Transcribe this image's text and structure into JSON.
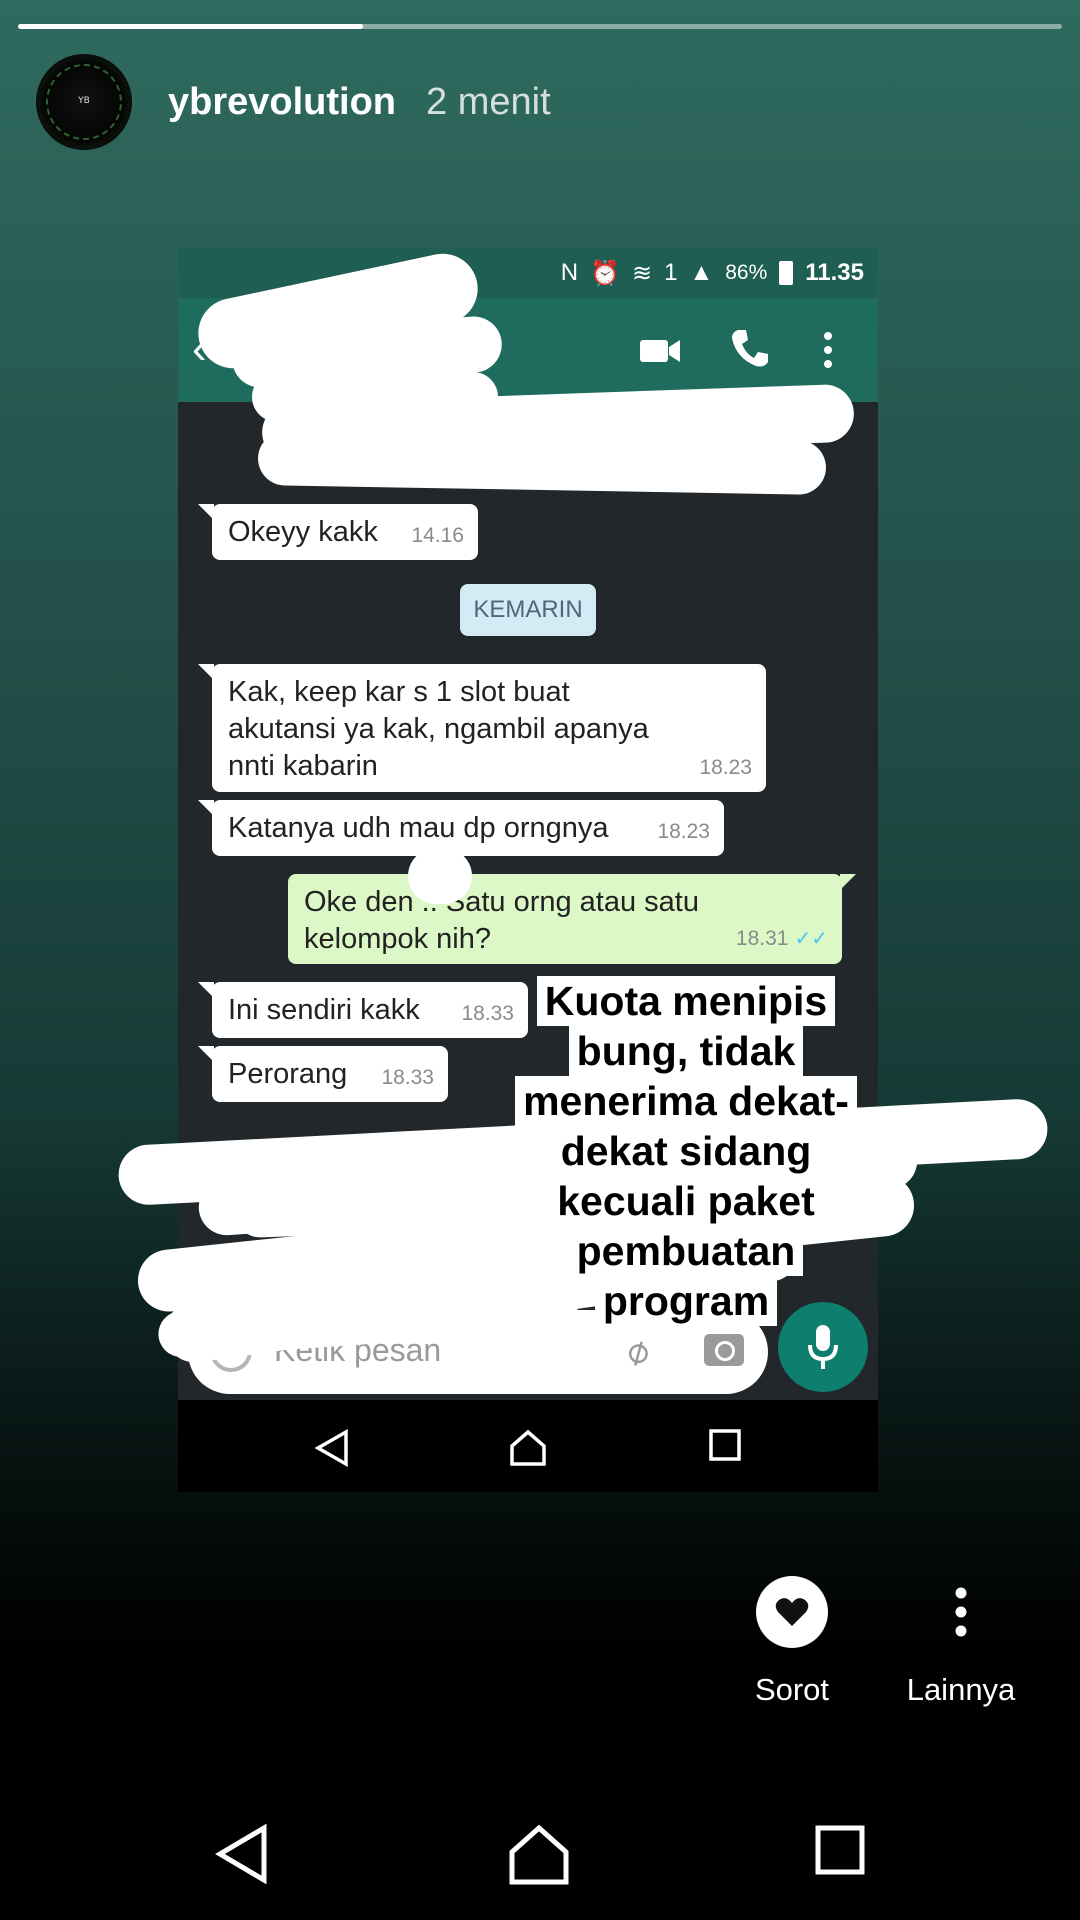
{
  "story": {
    "progress": 0.33,
    "username": "ybrevolution",
    "time_ago": "2 menit",
    "avatar_text": "YBRevolution"
  },
  "screenshot": {
    "status_bar": {
      "battery": "86%",
      "time": "11.35",
      "sim": "1"
    },
    "chat_partner_redacted": true,
    "date_divider": "KEMARIN",
    "messages": [
      {
        "direction": "in",
        "text": "Okeyy kakk",
        "time": "14.16"
      },
      {
        "direction": "in",
        "text": "Kak, keep kar   s 1 slot buat akutansi ya kak, ngambil apanya nnti  kabarin",
        "time": "18.23"
      },
      {
        "direction": "in",
        "text": "Katanya udh mau dp orngnya",
        "time": "18.23"
      },
      {
        "direction": "out",
        "text": "Oke den   .. Satu orng atau satu kelompok nih?",
        "time": "18.31"
      },
      {
        "direction": "in",
        "text": "Ini sendiri kakk",
        "time": "18.33"
      },
      {
        "direction": "in",
        "text": "Perorang",
        "time": "18.33"
      }
    ],
    "input_placeholder": "Ketik pesan"
  },
  "caption": "Kuota menipis bung, tidak menerima dekat-dekat sidang kecuali paket pembuatan program",
  "actions": {
    "highlight_label": "Sorot",
    "more_label": "Lainnya"
  },
  "colors": {
    "whatsapp_header": "#1f6b5e",
    "outgoing_bubble": "#dcf8c6",
    "mic_button": "#0e7f6e",
    "read_ticks": "#4fc3f7"
  }
}
